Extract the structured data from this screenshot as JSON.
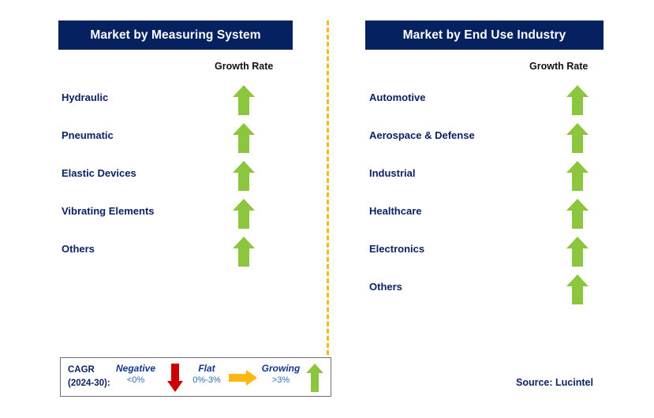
{
  "colors": {
    "header_bg": "#052160",
    "header_text": "#FFFFFF",
    "label_navy": "#0B2265",
    "arrow_green": "#8CC63F",
    "arrow_red": "#CC0000",
    "arrow_orange": "#FCB713",
    "divider_orange": "#FCB713",
    "legend_border": "#6D6D6D",
    "legend_value_blue": "#2C6AB0",
    "legend_word_blue": "#10368F"
  },
  "panels": [
    {
      "id": "measuring-system",
      "title": "Market by Measuring System",
      "growth_caption": "Growth Rate",
      "segments": [
        {
          "label": "Hydraulic",
          "trend": "growing",
          "icon": "arrow-up-icon"
        },
        {
          "label": "Pneumatic",
          "trend": "growing",
          "icon": "arrow-up-icon"
        },
        {
          "label": "Elastic Devices",
          "trend": "growing",
          "icon": "arrow-up-icon"
        },
        {
          "label": "Vibrating Elements",
          "trend": "growing",
          "icon": "arrow-up-icon"
        },
        {
          "label": "Others",
          "trend": "growing",
          "icon": "arrow-up-icon"
        }
      ]
    },
    {
      "id": "end-use-industry",
      "title": "Market by End Use Industry",
      "growth_caption": "Growth Rate",
      "segments": [
        {
          "label": "Automotive",
          "trend": "growing",
          "icon": "arrow-up-icon"
        },
        {
          "label": "Aerospace & Defense",
          "trend": "growing",
          "icon": "arrow-up-icon"
        },
        {
          "label": "Industrial",
          "trend": "growing",
          "icon": "arrow-up-icon"
        },
        {
          "label": "Healthcare",
          "trend": "growing",
          "icon": "arrow-up-icon"
        },
        {
          "label": "Electronics",
          "trend": "growing",
          "icon": "arrow-up-icon"
        },
        {
          "label": "Others",
          "trend": "growing",
          "icon": "arrow-up-icon"
        }
      ]
    }
  ],
  "legend": {
    "title_line1": "CAGR",
    "title_line2": "(2024-30):",
    "items": [
      {
        "label": "Negative",
        "range": "<0%",
        "icon": "arrow-down-icon",
        "color": "#CC0000"
      },
      {
        "label": "Flat",
        "range": "0%-3%",
        "icon": "arrow-right-icon",
        "color": "#FCB713"
      },
      {
        "label": "Growing",
        "range": ">3%",
        "icon": "arrow-up-icon",
        "color": "#8CC63F"
      }
    ]
  },
  "source": "Source: Lucintel",
  "chart_data": {
    "type": "table",
    "title": "Market Segment Growth Outlook",
    "legend": [
      "Negative <0%",
      "Flat 0%-3%",
      "Growing >3%"
    ],
    "categories": [
      "Hydraulic",
      "Pneumatic",
      "Elastic Devices",
      "Vibrating Elements",
      "Others",
      "Automotive",
      "Aerospace & Defense",
      "Industrial",
      "Healthcare",
      "Electronics",
      "Others"
    ],
    "values": [
      "growing",
      "growing",
      "growing",
      "growing",
      "growing",
      "growing",
      "growing",
      "growing",
      "growing",
      "growing",
      "growing"
    ],
    "series": [
      {
        "name": "Market by Measuring System",
        "categories": [
          "Hydraulic",
          "Pneumatic",
          "Elastic Devices",
          "Vibrating Elements",
          "Others"
        ],
        "values": [
          "growing",
          "growing",
          "growing",
          "growing",
          "growing"
        ]
      },
      {
        "name": "Market by End Use Industry",
        "categories": [
          "Automotive",
          "Aerospace & Defense",
          "Industrial",
          "Healthcare",
          "Electronics",
          "Others"
        ],
        "values": [
          "growing",
          "growing",
          "growing",
          "growing",
          "growing",
          "growing"
        ]
      }
    ],
    "xlabel": "Growth Rate",
    "ylabel": "",
    "grid": false,
    "legend_position": "bottom-left"
  }
}
